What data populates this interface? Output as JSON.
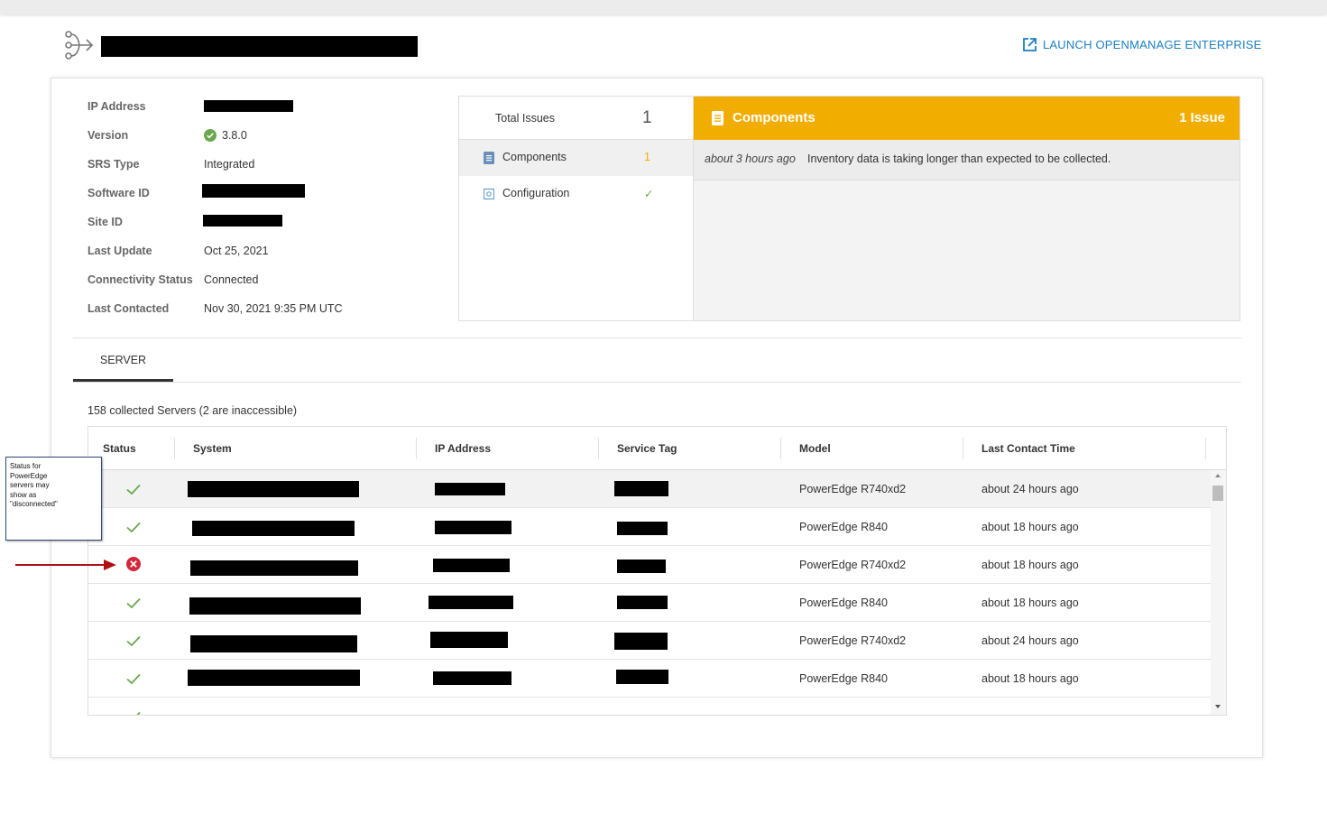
{
  "header": {
    "launch_label": "LAUNCH OPENMANAGE ENTERPRISE"
  },
  "info": {
    "ip_address_label": "IP Address",
    "version_label": "Version",
    "version_value": "3.8.0",
    "srs_type_label": "SRS Type",
    "srs_type_value": "Integrated",
    "software_id_label": "Software ID",
    "site_id_label": "Site ID",
    "last_update_label": "Last Update",
    "last_update_value": "Oct 25, 2021",
    "connectivity_label": "Connectivity Status",
    "connectivity_value": "Connected",
    "last_contacted_label": "Last Contacted",
    "last_contacted_value": "Nov 30, 2021 9:35 PM UTC"
  },
  "issues": {
    "total_label": "Total Issues",
    "total_count": "1",
    "categories": [
      {
        "label": "Components",
        "count": "1",
        "icon": "document-icon"
      },
      {
        "label": "Configuration",
        "count": "✓",
        "icon": "settings-icon"
      }
    ],
    "detail_title": "Components",
    "detail_count": "1 Issue",
    "detail_items": [
      {
        "time": "about 3 hours ago",
        "message": "Inventory data is taking longer than expected to be collected."
      }
    ]
  },
  "tabs": {
    "server_label": "SERVER"
  },
  "servers": {
    "summary": "158 collected Servers (2 are inaccessible)",
    "columns": [
      "Status",
      "System",
      "IP Address",
      "Service Tag",
      "Model",
      "Last Contact Time"
    ],
    "rows": [
      {
        "status": "ok",
        "model": "PowerEdge R740xd2",
        "last_contact": "about 24 hours ago"
      },
      {
        "status": "ok",
        "model": "PowerEdge R840",
        "last_contact": "about 18 hours ago"
      },
      {
        "status": "error",
        "model": "PowerEdge R740xd2",
        "last_contact": "about 18 hours ago"
      },
      {
        "status": "ok",
        "model": "PowerEdge R840",
        "last_contact": "about 18 hours ago"
      },
      {
        "status": "ok",
        "model": "PowerEdge R740xd2",
        "last_contact": "about 24 hours ago"
      },
      {
        "status": "ok",
        "model": "PowerEdge R840",
        "last_contact": "about 18 hours ago"
      }
    ]
  },
  "annotation": {
    "callout_text": "Status for PowerEdge servers may show as \"disconnected\""
  },
  "colors": {
    "accent": "#1a7fc1",
    "warning": "#f2ae00",
    "success": "#6aa84f",
    "error": "#d2283a"
  }
}
